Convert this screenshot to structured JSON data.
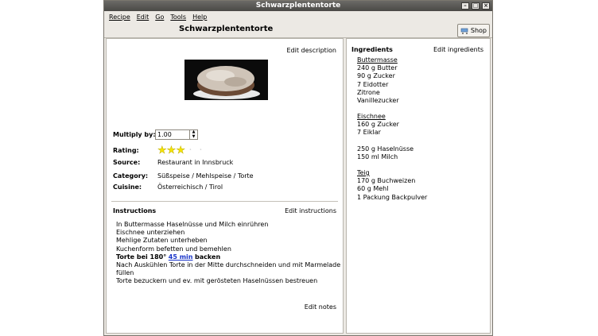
{
  "window": {
    "title": "Schwarzplententorte"
  },
  "menu": {
    "recipe": "Recipe",
    "edit": "Edit",
    "go": "Go",
    "tools": "Tools",
    "help": "Help"
  },
  "toolbar": {
    "title": "Schwarzplententorte",
    "shop_label": "Shop"
  },
  "details": {
    "edit_description": "Edit description",
    "multiply_label": "Multiply by:",
    "multiply_value": "1.00",
    "rating_label": "Rating:",
    "rating_value": 3,
    "rating_max": 5,
    "source_label": "Source:",
    "source_value": "Restaurant in Innsbruck",
    "category_label": "Category:",
    "category_value": "Süßspeise / Mehlspeise / Torte",
    "cuisine_label": "Cuisine:",
    "cuisine_value": "Österreichisch / Tirol"
  },
  "instructions": {
    "heading": "Instructions",
    "edit_label": "Edit instructions",
    "lines": [
      "In Buttermasse Haselnüsse und Milch einrühren",
      "Eischnee unterziehen",
      "Mehlige Zutaten unterheben",
      "Kuchenform befetten und bemehlen"
    ],
    "bake_prefix": "Torte bei 180°",
    "bake_time": "45 min",
    "bake_suffix": "backen",
    "lines_after": [
      "Nach Auskühlen Torte in der Mitte durchschneiden und mit Marmelade",
      "füllen",
      "Torte bezuckern und ev. mit gerösteten Haselnüssen bestreuen"
    ],
    "edit_notes": "Edit notes"
  },
  "ingredients": {
    "heading": "Ingredients",
    "edit_label": "Edit ingredients",
    "groups": [
      {
        "name": "Buttermasse",
        "items": [
          "240 g Butter",
          "90 g Zucker",
          "7 Eidotter",
          "Zitrone",
          "Vanillezucker"
        ]
      },
      {
        "name": "Eischnee",
        "items": [
          "160 g Zucker",
          "7 Eiklar",
          "",
          "250 g Haselnüsse",
          "150 ml Milch"
        ]
      },
      {
        "name": "Teig",
        "items": [
          "170 g Buchweizen",
          "60 g Mehl",
          "1 Packung Backpulver"
        ]
      }
    ]
  },
  "colors": {
    "star_filled": "#f5e400",
    "star_empty": "#d8d8d8",
    "link": "#1a35c9"
  }
}
